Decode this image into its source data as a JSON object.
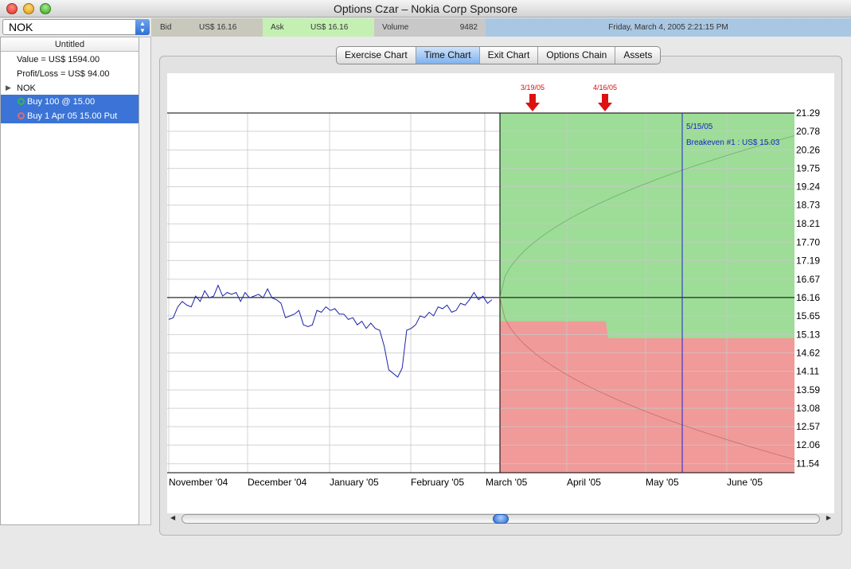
{
  "window": {
    "title": "Options Czar –  Nokia Corp Sponsore"
  },
  "ticker": {
    "value": "NOK"
  },
  "quote": {
    "bid_label": "Bid",
    "bid_value": "US$ 16.16",
    "ask_label": "Ask",
    "ask_value": "US$ 16.16",
    "volume_label": "Volume",
    "volume_value": "9482",
    "datetime": "Friday, March 4, 2005 2:21:15 PM"
  },
  "colors": {
    "bid_bg": "#c8c8bd",
    "ask_bg": "#c5f0b3",
    "volume_bg": "#c8c8c8",
    "date_bg": "#a9c7e2",
    "profit_green": "#9ddd98",
    "loss_red": "#f09a99",
    "price_line": "#1a23a8",
    "marker_red": "#dd1111"
  },
  "sidebar": {
    "header": "Untitled",
    "value": "Value = US$ 1594.00",
    "profit_loss": "Profit/Loss = US$ 94.00",
    "symbol": "NOK",
    "position_1": "Buy 100 @ 15.00",
    "position_2": "Buy 1 Apr 05 15.00 Put"
  },
  "tabs": [
    "Exercise Chart",
    "Time Chart",
    "Exit Chart",
    "Options Chain",
    "Assets"
  ],
  "active_tab": "Time Chart",
  "chart_data": {
    "type": "line",
    "x_labels": [
      "November '04",
      "December '04",
      "January '05",
      "February '05",
      "March '05",
      "April '05",
      "May '05",
      "June '05"
    ],
    "y_ticks": [
      21.29,
      20.78,
      20.26,
      19.75,
      19.24,
      18.73,
      18.21,
      17.7,
      17.19,
      16.67,
      16.16,
      15.65,
      15.13,
      14.62,
      14.11,
      13.59,
      13.08,
      12.57,
      12.06,
      11.54
    ],
    "current_price": 16.16,
    "events": [
      {
        "date": "3/19/05",
        "label": "3/19/05"
      },
      {
        "date": "4/16/05",
        "label": "4/16/05"
      }
    ],
    "breakeven": {
      "date": "5/15/05",
      "date_label": "5/15/05",
      "label": "Breakeven #1 : US$ 15.03",
      "price": 15.03
    },
    "price_series": [
      15.55,
      15.6,
      15.9,
      16.05,
      15.95,
      15.9,
      16.2,
      16.05,
      16.35,
      16.15,
      16.2,
      16.5,
      16.2,
      16.3,
      16.25,
      16.3,
      16.05,
      16.3,
      16.15,
      16.2,
      16.25,
      16.15,
      16.4,
      16.15,
      16.1,
      16.0,
      15.6,
      15.65,
      15.7,
      15.8,
      15.4,
      15.35,
      15.4,
      15.8,
      15.75,
      15.9,
      15.8,
      15.85,
      15.7,
      15.7,
      15.55,
      15.6,
      15.4,
      15.5,
      15.3,
      15.45,
      15.3,
      15.25,
      14.8,
      14.15,
      14.05,
      13.95,
      14.2,
      15.25,
      15.3,
      15.4,
      15.65,
      15.6,
      15.75,
      15.65,
      15.9,
      15.85,
      15.95,
      15.75,
      15.8,
      16.0,
      15.95,
      16.1,
      16.3,
      16.1,
      16.2,
      16.0,
      16.1
    ],
    "ylim": [
      11.29,
      21.29
    ]
  }
}
